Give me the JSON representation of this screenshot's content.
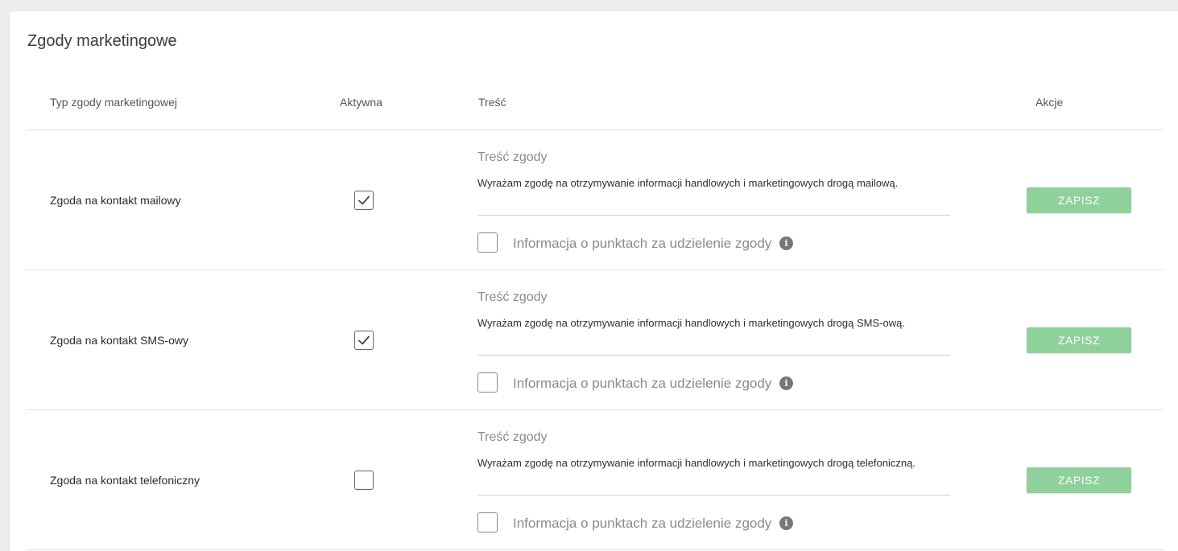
{
  "card": {
    "title": "Zgody marketingowe"
  },
  "table": {
    "headers": {
      "type": "Typ zgody marketingowej",
      "active": "Aktywna",
      "content": "Treść",
      "actions": "Akcje"
    },
    "rows": [
      {
        "label": "Zgoda na kontakt mailowy",
        "active": true,
        "content_label": "Treść zgody",
        "content_text": "Wyrażam zgodę na otrzymywanie informacji handlowych i marketingowych drogą mailową.",
        "points_checked": false,
        "points_label": "Informacja o punktach za udzielenie zgody",
        "save_label": "ZAPISZ"
      },
      {
        "label": "Zgoda na kontakt SMS-owy",
        "active": true,
        "content_label": "Treść zgody",
        "content_text": "Wyrażam zgodę na otrzymywanie informacji handlowych i marketingowych drogą SMS-ową.",
        "points_checked": false,
        "points_label": "Informacja o punktach za udzielenie zgody",
        "save_label": "ZAPISZ"
      },
      {
        "label": "Zgoda na kontakt telefoniczny",
        "active": false,
        "content_label": "Treść zgody",
        "content_text": "Wyrażam zgodę na otrzymywanie informacji handlowych i marketingowych drogą telefoniczną.",
        "points_checked": false,
        "points_label": "Informacja o punktach za udzielenie zgody",
        "save_label": "ZAPISZ"
      }
    ]
  },
  "icons": {
    "check": "check-icon",
    "info": "info-icon"
  },
  "colors": {
    "save_button": "#8fd19a",
    "background": "#eeeeee",
    "card": "#ffffff"
  }
}
